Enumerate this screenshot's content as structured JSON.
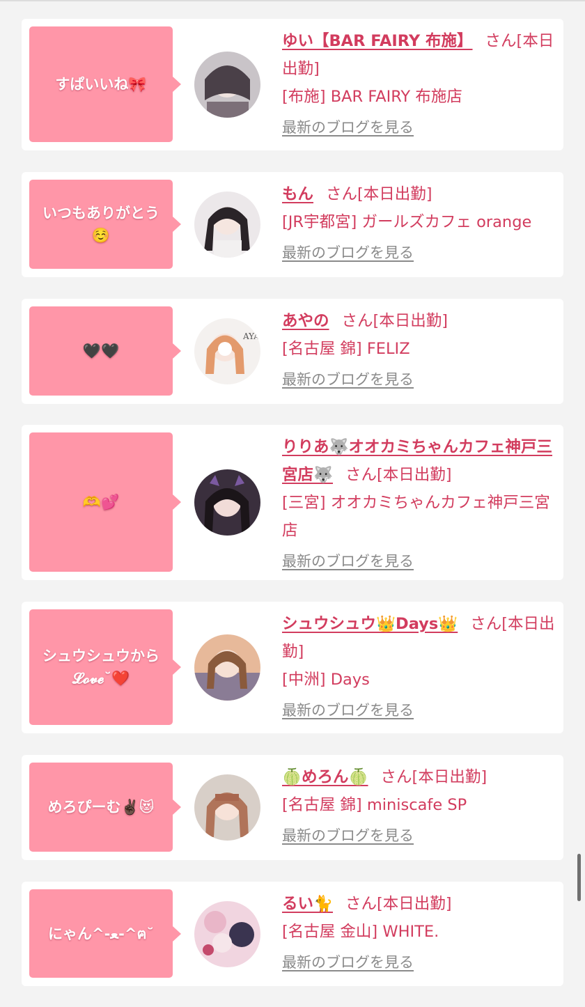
{
  "blog_link_label": "最新のブログを見る",
  "san_label": "さん",
  "colors": {
    "accent": "#d23c5e",
    "bubble": "#ff96a8",
    "link_gray": "#8a8a8a"
  },
  "items": [
    {
      "message": "すぱいいね🎀",
      "name": "ゆい【BAR FAIRY 布施】",
      "status": "[本日出勤]",
      "shop": "[布施] BAR FAIRY 布施店",
      "avatar_icon": "girl-photo-avatar"
    },
    {
      "message": "いつもありがとう☺️",
      "name": "もん",
      "status": "[本日出勤]",
      "shop": "[JR宇都宮] ガールズカフェ orange",
      "avatar_icon": "girl-photo-avatar"
    },
    {
      "message": "🖤🖤",
      "name": "あやの",
      "status": "[本日出勤]",
      "shop": "[名古屋 錦] FELIZ",
      "avatar_icon": "girl-photo-avatar"
    },
    {
      "message": "🫶💕",
      "name": "りりあ🐺オオカミちゃんカフェ神戸三宮店🐺",
      "status": "[本日出勤]",
      "shop": "[三宮] オオカミちゃんカフェ神戸三宮店",
      "avatar_icon": "girl-photo-avatar"
    },
    {
      "message": "シュウシュウから𝓛𝓸𝓿𝓮˘❤️",
      "name": "シュウシュウ👑Days👑",
      "status": "[本日出勤]",
      "shop": "[中洲] Days",
      "avatar_icon": "girl-photo-avatar"
    },
    {
      "message": "めろぴーむ✌🏿😻",
      "name": "🍈めろん🍈",
      "status": "[本日出勤]",
      "shop": "[名古屋 錦] miniscafe SP",
      "avatar_icon": "girl-photo-avatar"
    },
    {
      "message": "にゃん^-ﻌ-^ฅ˘",
      "name": "るい🐈",
      "status": "[本日出勤]",
      "shop": "[名古屋 金山] WHITE.",
      "avatar_icon": "girl-photo-avatar"
    }
  ]
}
